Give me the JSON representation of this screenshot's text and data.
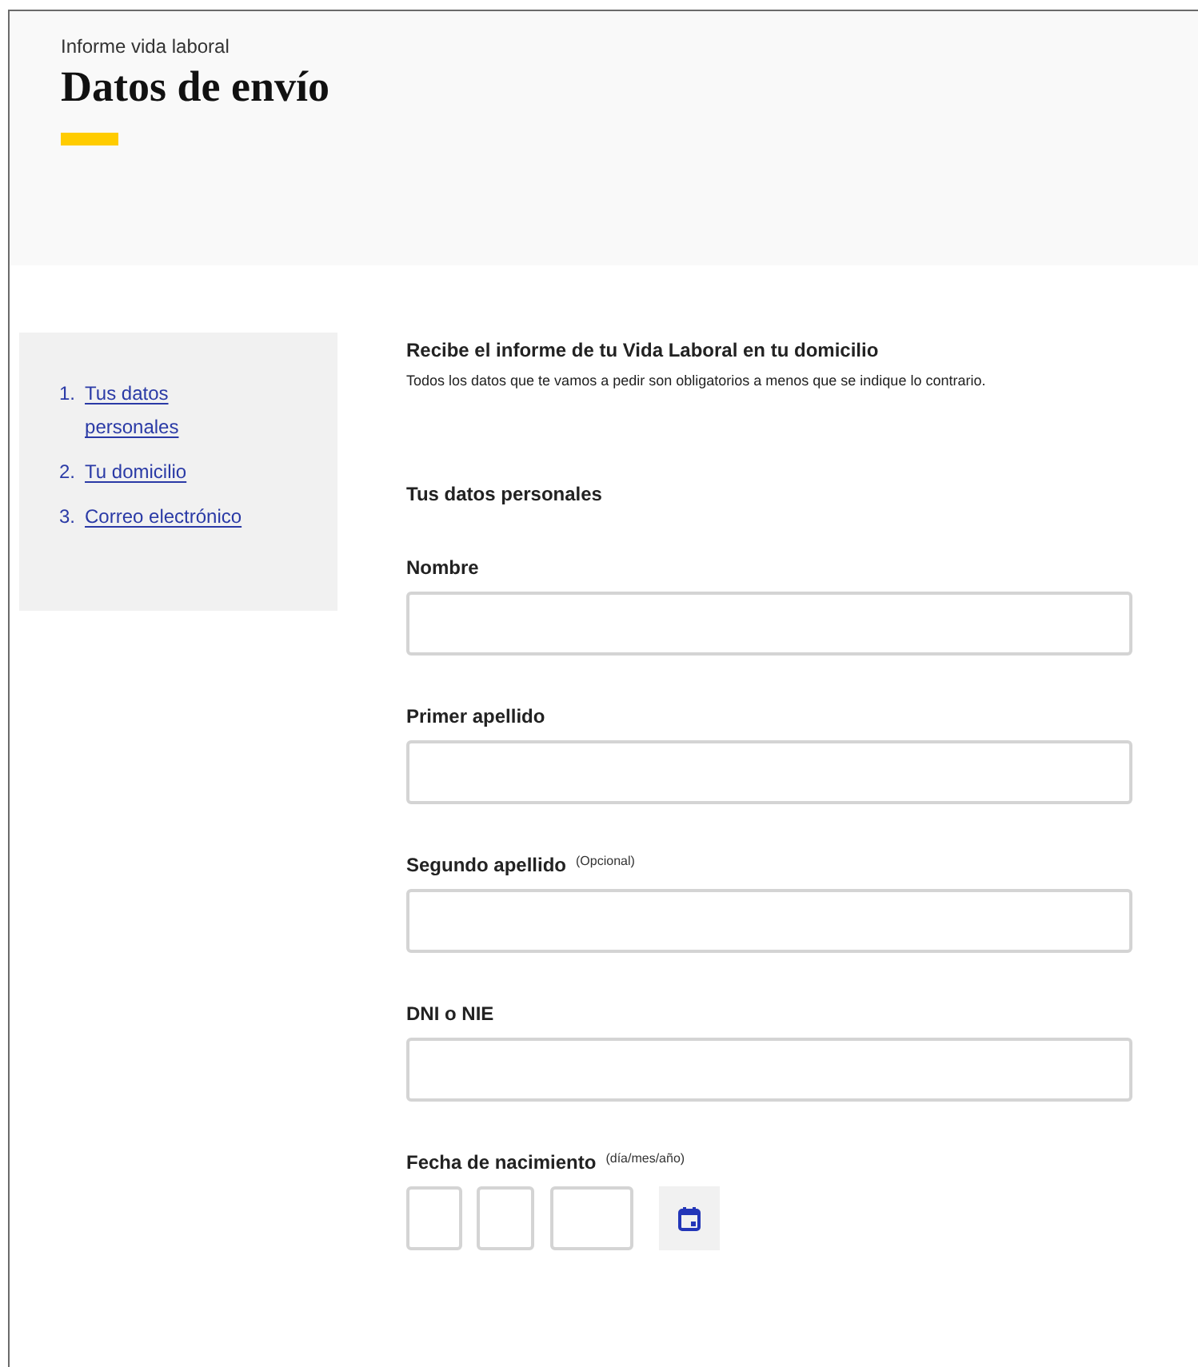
{
  "header": {
    "subtitle": "Informe vida laboral",
    "title": "Datos de envío"
  },
  "nav": [
    {
      "number": "1.",
      "label": "Tus datos personales"
    },
    {
      "number": "2.",
      "label": "Tu domicilio"
    },
    {
      "number": "3.",
      "label": "Correo electrónico"
    }
  ],
  "intro": {
    "title": "Recibe el informe de tu Vida Laboral en tu domicilio",
    "text": "Todos los datos que te vamos a pedir son obligatorios a menos que se indique lo contrario."
  },
  "section_title": "Tus datos personales",
  "fields": [
    {
      "kind": "text",
      "label": "Nombre"
    },
    {
      "kind": "text",
      "label": "Primer apellido"
    },
    {
      "kind": "text",
      "label": "Segundo apellido",
      "hint": "(Opcional)"
    },
    {
      "kind": "text",
      "label": "DNI o NIE"
    },
    {
      "kind": "date",
      "label": "Fecha de nacimiento",
      "hint": "(día/mes/año)"
    }
  ]
}
